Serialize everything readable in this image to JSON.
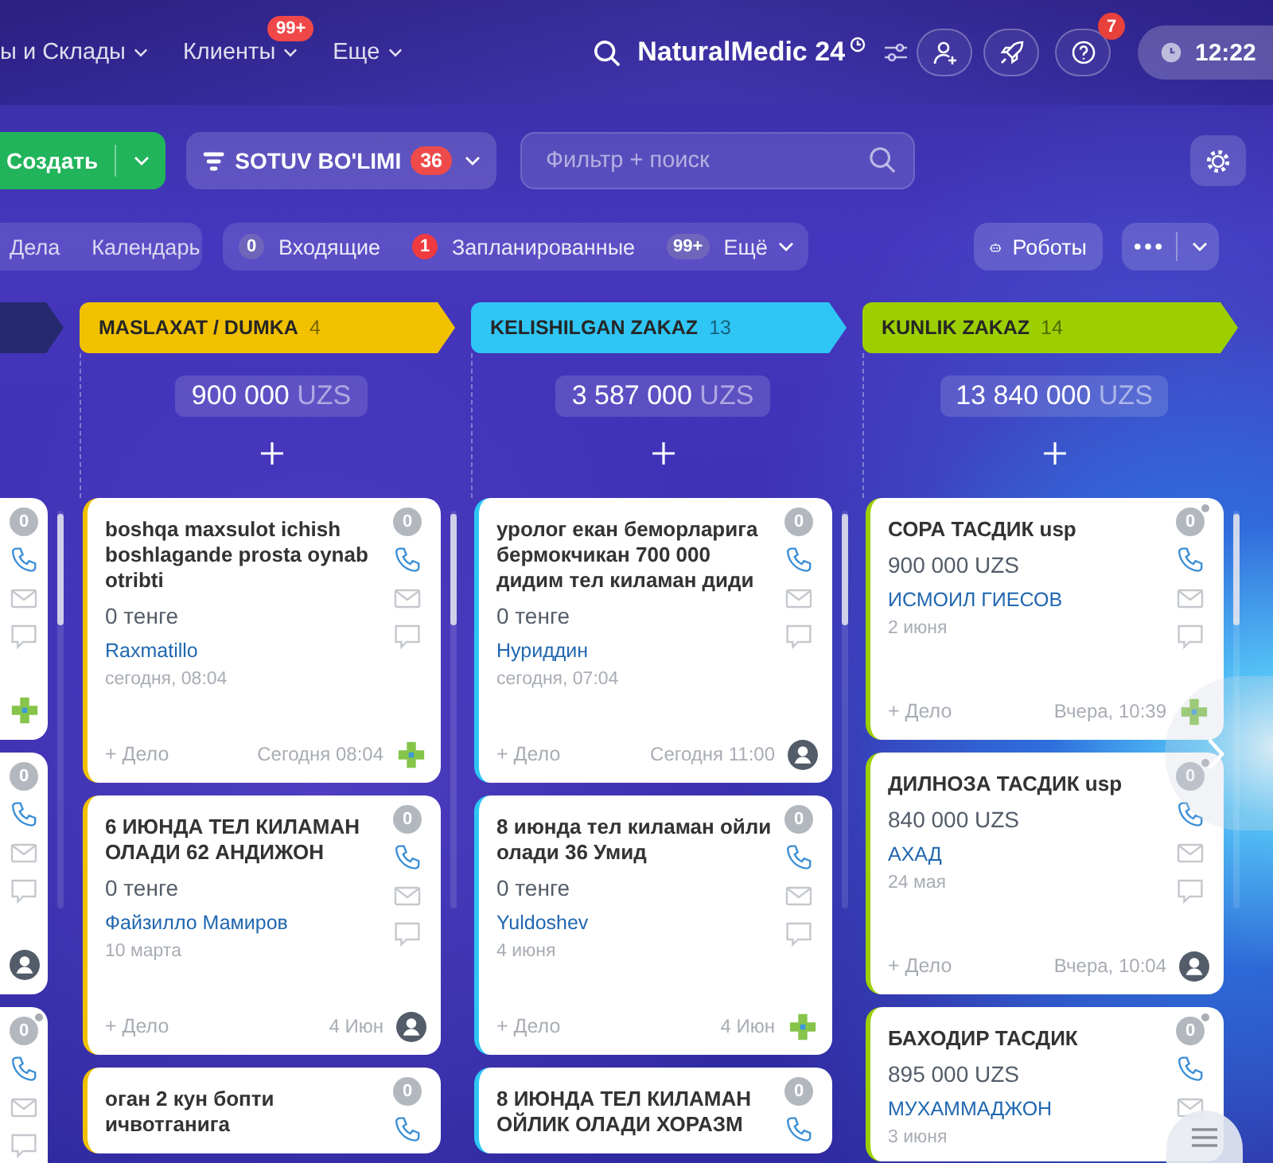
{
  "top_nav": {
    "items": [
      {
        "label": "ы и Склады"
      },
      {
        "label": "Клиенты",
        "badge": "99+"
      },
      {
        "label": "Еще"
      }
    ],
    "logo": {
      "name": "NaturalMedic",
      "suffix": "24"
    },
    "help_badge": "7",
    "time": "12:22"
  },
  "toolbar": {
    "create_button": "Создать",
    "pipeline": {
      "label": "SOTUV BO'LIMI",
      "badge": "36"
    },
    "search": {
      "placeholder": "Фильтр + поиск"
    }
  },
  "view_bar": {
    "views": [
      {
        "label": "Дела",
        "selected": false
      },
      {
        "label": "Календарь",
        "selected": false
      }
    ],
    "counters": [
      {
        "count": "0",
        "label": "Входящие",
        "color": "#6f66bb",
        "dropdown": false
      },
      {
        "count": "1",
        "label": "Запланированные",
        "color": "#ef3b3f",
        "dropdown": false
      },
      {
        "count": "99+",
        "label": "Ещё",
        "color": "#6f66bb",
        "dropdown": true
      }
    ],
    "robots_button": "Роботы"
  },
  "partial_column": {
    "color": "#252a6e",
    "cards": [
      {
        "counter": "0",
        "counter_dot": false,
        "owner": {
          "kind": "logo"
        }
      },
      {
        "counter": "0",
        "counter_dot": false,
        "owner": {
          "kind": "avatar"
        }
      },
      {
        "counter": "0",
        "counter_dot": true
      }
    ]
  },
  "columns": [
    {
      "title": "MASLAXAT / DUMKA",
      "count": "4",
      "color": "#f1c100",
      "total": "900 000",
      "currency": "UZS",
      "cards": [
        {
          "title": "boshqa maxsulot ichish boshlagande prosta oynab otribti",
          "amount": "0 тенге",
          "contact": "Raxmatillo",
          "date": "сегодня, 08:04",
          "action": "+ Дело",
          "time": "Сегодня 08:04",
          "owner": {
            "kind": "logo"
          },
          "counter": "0",
          "counter_dot": false
        },
        {
          "title": "6 ИЮНДА ТЕЛ КИЛАМАН ОЛАДИ 62 АНДИЖОН",
          "amount": "0 тенге",
          "contact": "Файзилло Мамиров",
          "date": "10 марта",
          "action": "+ Дело",
          "time": "4 Июн",
          "owner": {
            "kind": "avatar"
          },
          "counter": "0",
          "counter_dot": false
        },
        {
          "title": "оган 2 кун бопти ичвотганига",
          "counter": "0",
          "counter_dot": false
        }
      ]
    },
    {
      "title": "KELISHILGAN ZAKAZ",
      "count": "13",
      "color": "#2fc6f6",
      "total": "3 587 000",
      "currency": "UZS",
      "cards": [
        {
          "title": "уролог екан беморларига бермокчикан 700 000 дидим тел киламан диди",
          "amount": "0 тенге",
          "contact": "Нуриддин",
          "date": "сегодня, 07:04",
          "action": "+ Дело",
          "time": "Сегодня 11:00",
          "owner": {
            "kind": "avatar"
          },
          "counter": "0",
          "counter_dot": false
        },
        {
          "title": "8 июнда тел киламан ойли олади 36 Умид",
          "amount": "0 тенге",
          "contact": "Yuldoshev",
          "date": "4 июня",
          "action": "+ Дело",
          "time": "4 Июн",
          "owner": {
            "kind": "logo"
          },
          "counter": "0",
          "counter_dot": false
        },
        {
          "title": "8 ИЮНДА ТЕЛ КИЛАМАН ОЙЛИК ОЛАДИ ХОРАЗМ",
          "counter": "0",
          "counter_dot": false
        }
      ]
    },
    {
      "title": "KUNLIK ZAKAZ",
      "count": "14",
      "color": "#9dcf00",
      "total": "13 840 000",
      "currency": "UZS",
      "cards": [
        {
          "title": "СОРА ТАСДИК usp",
          "amount": "900 000 UZS",
          "contact": "ИСМОИЛ ГИЕСОВ",
          "date": "2 июня",
          "action": "+ Дело",
          "time": "Вчера, 10:39",
          "owner": {
            "kind": "logo"
          },
          "counter": "0",
          "counter_dot": true
        },
        {
          "title": "ДИЛНОЗА ТАСДИК usp",
          "amount": "840 000 UZS",
          "contact": "АХАД",
          "date": "24 мая",
          "action": "+ Дело",
          "time": "Вчера, 10:04",
          "owner": {
            "kind": "avatar"
          },
          "counter": "0",
          "counter_dot": true
        },
        {
          "title": "БАХОДИР ТАСДИК",
          "amount": "895 000 UZS",
          "contact": "МУХАММАДЖОН",
          "date": "3 июня",
          "counter": "0",
          "counter_dot": true
        }
      ]
    }
  ]
}
